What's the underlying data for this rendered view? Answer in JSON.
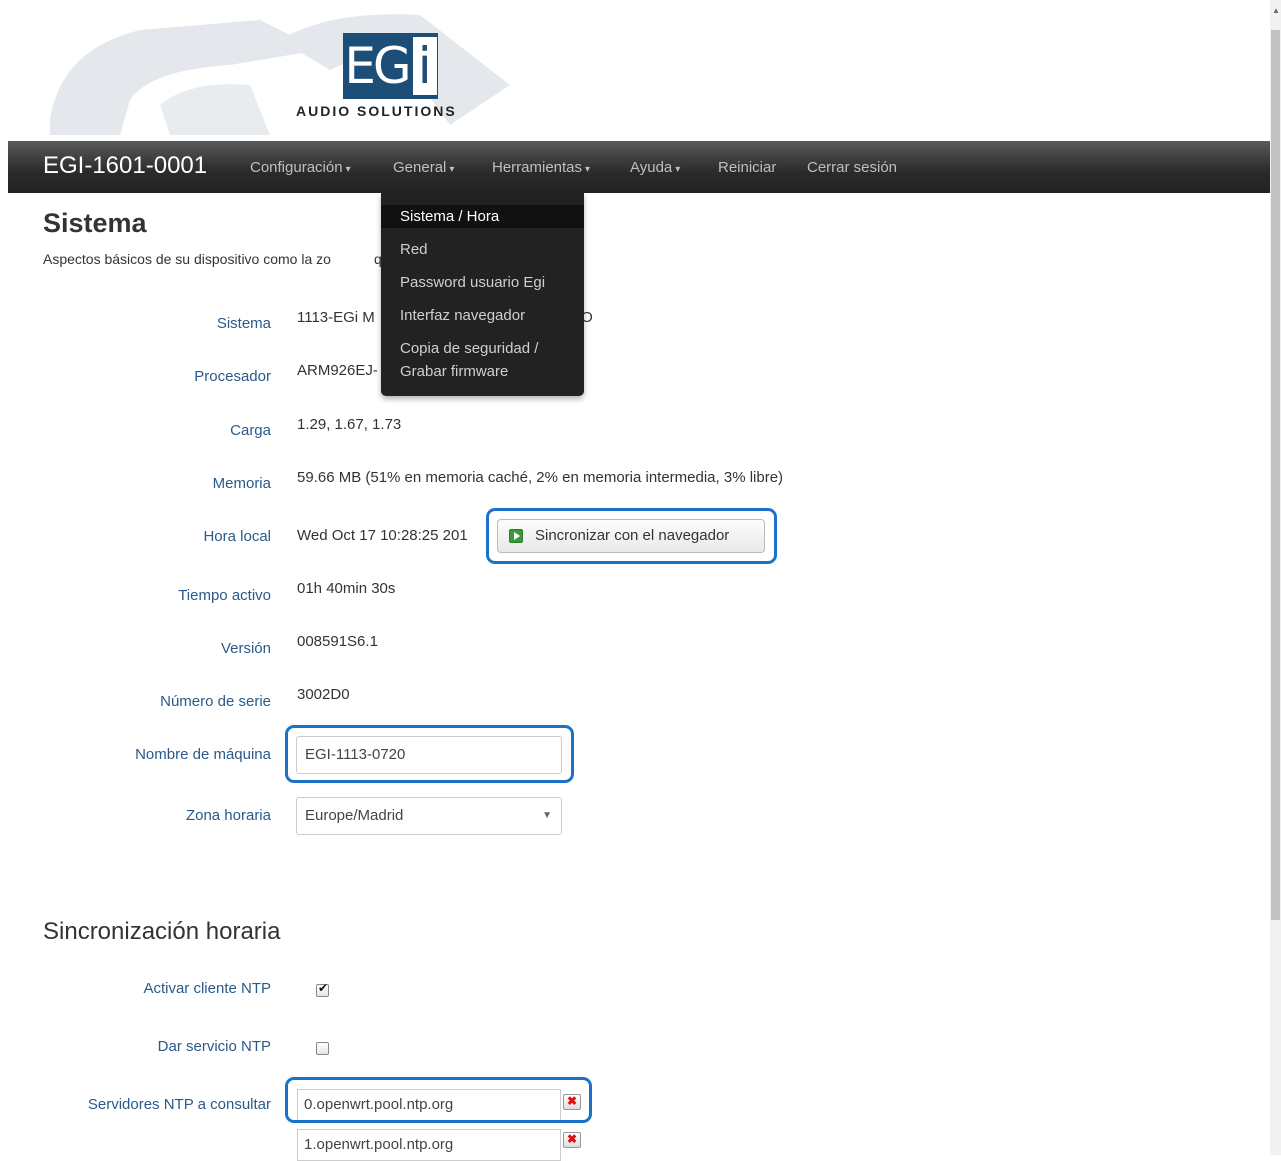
{
  "logo": {
    "letters": "EG",
    "letter_i": "i",
    "subtitle": "AUDIO SOLUTIONS"
  },
  "navbar": {
    "brand": "EGI-1601-0001",
    "items": [
      {
        "label": "Configuración",
        "caret": "▾"
      },
      {
        "label": "General",
        "caret": "▾"
      },
      {
        "label": "Herramientas",
        "caret": "▾"
      },
      {
        "label": "Ayuda",
        "caret": "▾"
      },
      {
        "label": "Reiniciar"
      },
      {
        "label": "Cerrar sesión"
      }
    ]
  },
  "dropdown": {
    "items": [
      {
        "label": "Sistema / Hora",
        "active": true
      },
      {
        "label": "Red"
      },
      {
        "label": "Password usuario Egi"
      },
      {
        "label": "Interfaz navegador"
      },
      {
        "label": "Copia de seguridad /"
      },
      {
        "label": "Grabar firmware"
      }
    ]
  },
  "page": {
    "title": "Sistema",
    "description_start": "Aspectos básicos de su dispositivo como la zo",
    "description_end": "quina."
  },
  "fields": {
    "sistema": {
      "label": "Sistema",
      "value_start": "1113-EGi M",
      "value_end": "I/O"
    },
    "procesador": {
      "label": "Procesador",
      "value": "ARM926EJ-"
    },
    "carga": {
      "label": "Carga",
      "value": "1.29, 1.67, 1.73"
    },
    "memoria": {
      "label": "Memoria",
      "value": "59.66 MB (51% en memoria caché, 2% en memoria intermedia, 3% libre)"
    },
    "hora_local": {
      "label": "Hora local",
      "value": "Wed Oct 17 10:28:25 201",
      "sync_button": "Sincronizar con el navegador"
    },
    "tiempo_activo": {
      "label": "Tiempo activo",
      "value": "01h 40min 30s"
    },
    "version": {
      "label": "Versión",
      "value": "008591S6.1"
    },
    "numero_serie": {
      "label": "Número de serie",
      "value": "3002D0"
    },
    "nombre_maquina": {
      "label": "Nombre de máquina",
      "value": "EGI-1113-0720"
    },
    "zona_horaria": {
      "label": "Zona horaria",
      "value": "Europe/Madrid",
      "arrow": "▼"
    }
  },
  "ntp": {
    "section_title": "Sincronización horaria",
    "activar_label": "Activar cliente NTP",
    "activar_checked": true,
    "tick": "✔",
    "servicio_label": "Dar servicio NTP",
    "servicio_checked": false,
    "servers_label": "Servidores NTP a consultar",
    "servers": [
      "0.openwrt.pool.ntp.org",
      "1.openwrt.pool.ntp.org"
    ],
    "delete_glyph": "✖"
  },
  "colors": {
    "navbar": "#2a2a2a",
    "highlight": "#1a73c8",
    "label": "#2a5a8a",
    "logo_blue": "#1d4e78"
  }
}
